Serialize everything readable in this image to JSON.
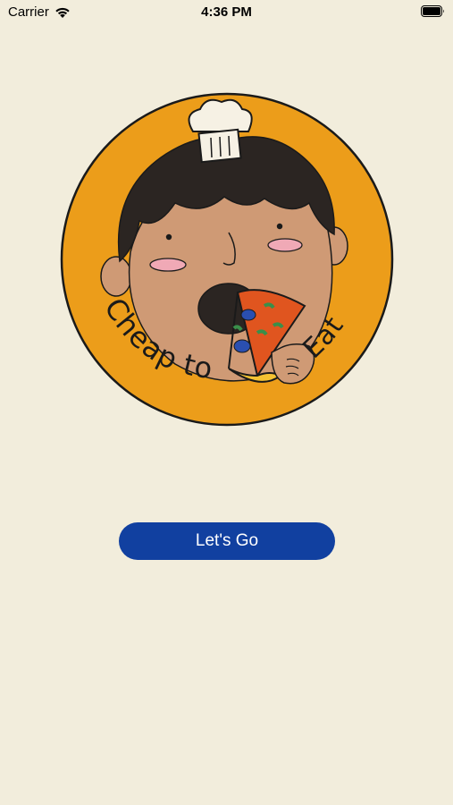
{
  "status_bar": {
    "carrier": "Carrier",
    "time": "4:36 PM",
    "icons": [
      "wifi-icon",
      "battery-icon"
    ]
  },
  "logo": {
    "text_left": "Cheap to",
    "text_right": "Eat",
    "colors": {
      "circle": "#ec9d1a",
      "skin": "#cf9a75",
      "hair": "#2b2522",
      "cheek": "#f0a9b6",
      "pizza_crust": "#f4c232",
      "pizza_sauce": "#e0551f",
      "outline": "#1a1a1a"
    }
  },
  "cta": {
    "label": "Let's Go",
    "color": "#1140a0"
  },
  "background": "#f2eddc"
}
